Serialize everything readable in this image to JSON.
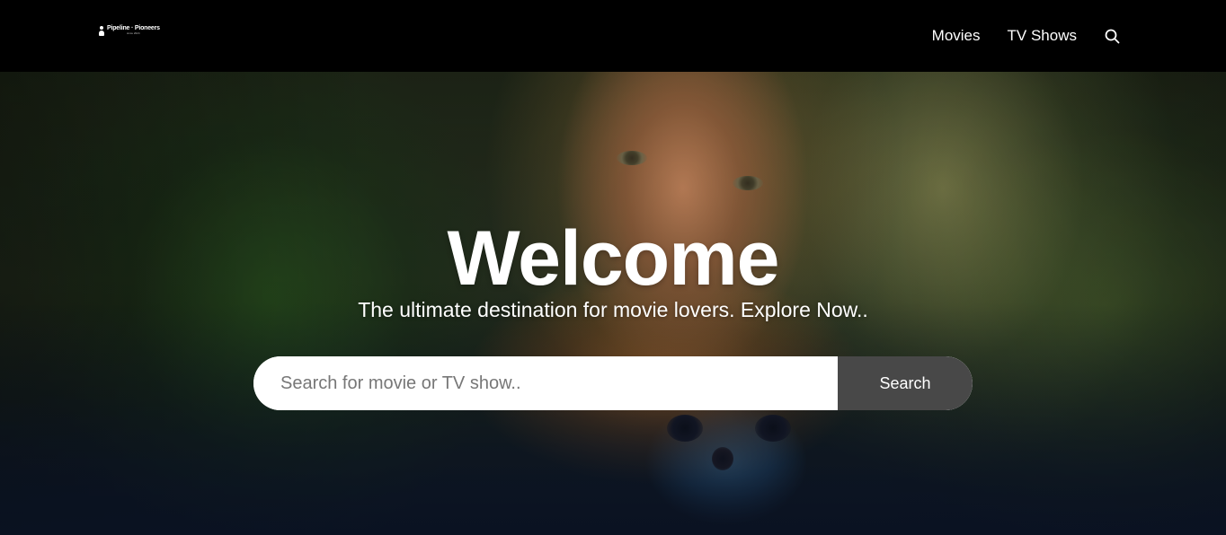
{
  "header": {
    "logo": {
      "text": "Pipeline · Pioneers",
      "subtext": "since 2024"
    },
    "nav": {
      "movies_label": "Movies",
      "tv_label": "TV Shows",
      "search_icon": "search-icon"
    }
  },
  "hero": {
    "title": "Welcome",
    "subtitle": "The ultimate destination for movie lovers. Explore Now..",
    "search": {
      "placeholder": "Search for movie or TV show..",
      "value": "",
      "button_label": "Search"
    }
  },
  "colors": {
    "header_bg": "#000000",
    "text": "#ffffff",
    "search_button_bg": "#484848",
    "search_input_bg": "#ffffff"
  }
}
